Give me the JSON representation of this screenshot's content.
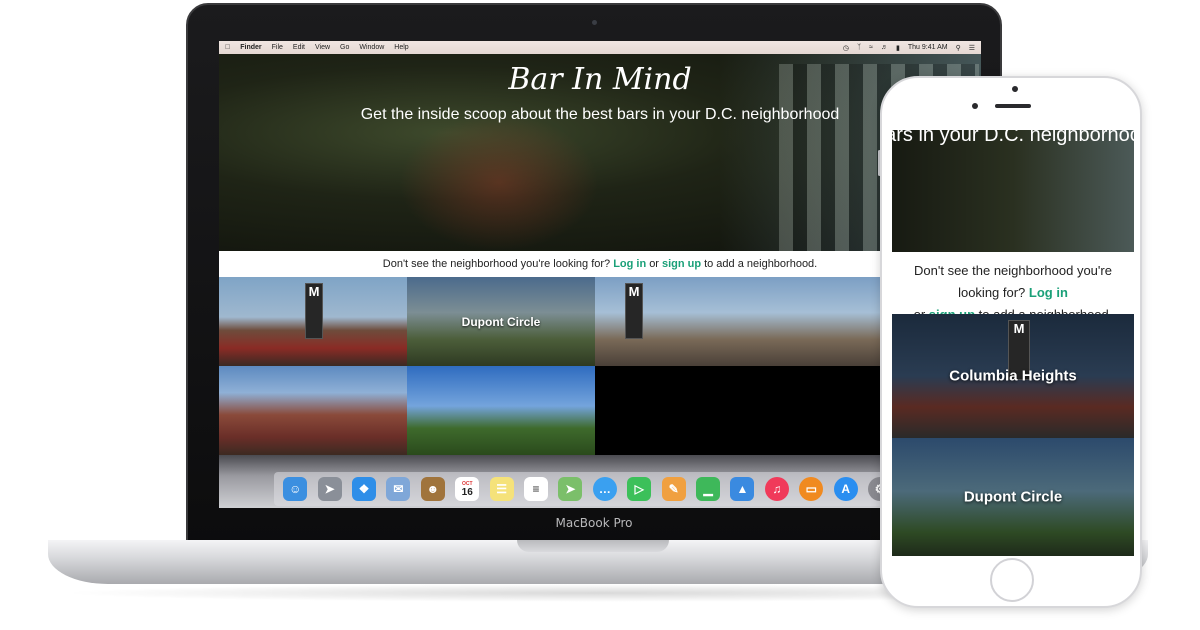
{
  "macbook": {
    "brand_label": "MacBook Pro",
    "menubar": {
      "apple_icon": "apple-logo-icon",
      "app_name": "Finder",
      "menus": [
        "File",
        "Edit",
        "View",
        "Go",
        "Window",
        "Help"
      ],
      "clock": "Thu 9:41 AM"
    },
    "site": {
      "title": "Bar In Mind",
      "subtitle": "Get the inside scoop about the best bars in your D.C. neighborhood",
      "cta": {
        "prefix": "Don't see the neighborhood you're looking for?",
        "login": "Log in",
        "middle": "or",
        "signup": "sign up",
        "suffix": "to add a neighborhood."
      },
      "tiles": [
        {
          "label": ""
        },
        {
          "label": "Dupont Circle"
        },
        {
          "label": ""
        },
        {
          "label": ""
        },
        {
          "label": ""
        }
      ],
      "link_color": "#1aa078"
    },
    "dock": {
      "calendar_month": "OCT",
      "calendar_day": "16",
      "icons": [
        "finder-icon",
        "launchpad-icon",
        "safari-icon",
        "mail-icon",
        "contacts-icon",
        "calendar-icon",
        "notes-icon",
        "reminders-icon",
        "maps-icon",
        "messages-icon",
        "facetime-icon",
        "pages-icon",
        "numbers-icon",
        "keynote-icon",
        "itunes-icon",
        "ibooks-icon",
        "app-store-icon",
        "system-preferences-icon",
        "downloads-folder-icon"
      ]
    }
  },
  "iphone": {
    "hero_text": "bars in your D.C. neighborhood",
    "cta": {
      "prefix": "Don't see the neighborhood you're looking for?",
      "login": "Log in",
      "middle": "or",
      "signup": "sign up",
      "suffix": "to add a neighborhood."
    },
    "tiles": [
      {
        "label": "Columbia Heights"
      },
      {
        "label": "Dupont Circle"
      }
    ]
  }
}
